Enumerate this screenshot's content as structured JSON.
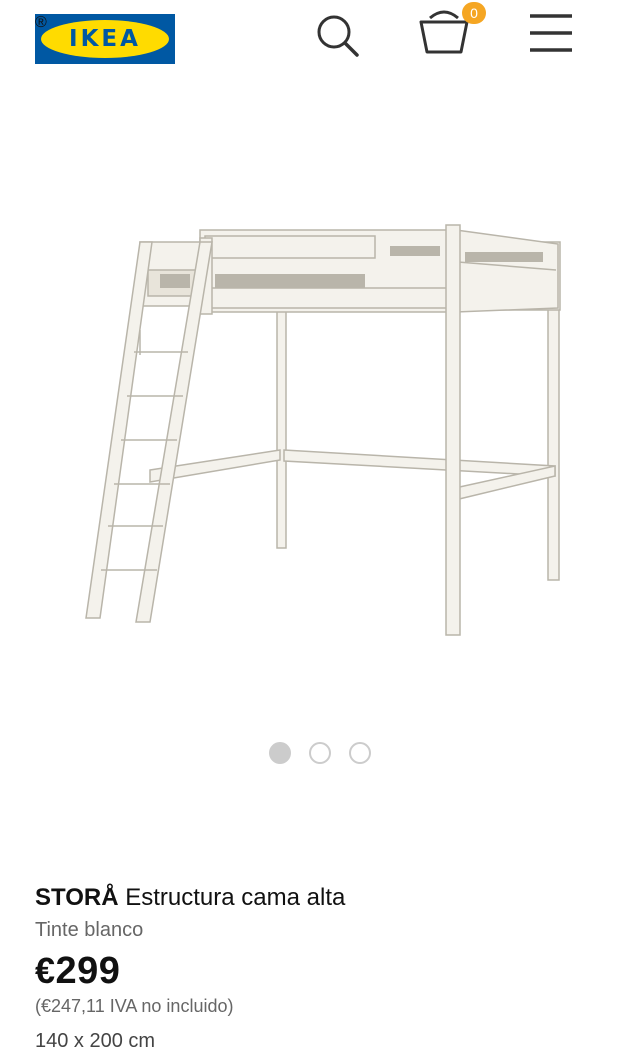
{
  "header": {
    "logo_text": "IKEA",
    "logo_registered": "®",
    "cart_count": "0",
    "colors": {
      "logo_blue": "#0058a3",
      "logo_yellow": "#ffdb00",
      "badge": "#f5a623"
    },
    "icons": [
      "search-icon",
      "basket-icon",
      "menu-icon"
    ]
  },
  "carousel": {
    "total_images": 3,
    "active_index": 0
  },
  "product": {
    "brand": "STORÅ",
    "name": "Estructura cama alta",
    "variant": "Tinte blanco",
    "currency": "€",
    "price": "299",
    "price_excl_vat": "(€247,11 IVA no incluido)",
    "size": "140 x 200 cm"
  }
}
